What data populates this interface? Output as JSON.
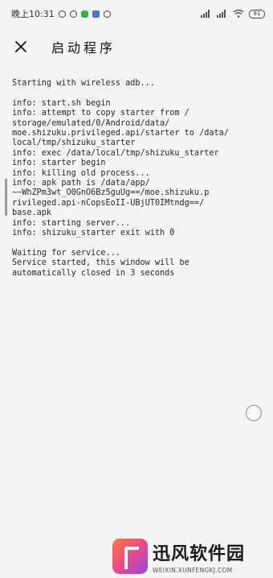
{
  "status_bar": {
    "time": "晚上10:31",
    "battery": "91"
  },
  "header": {
    "title": "启动程序"
  },
  "console": {
    "lines": [
      "Starting with wireless adb...",
      "",
      "info: start.sh begin",
      "info: attempt to copy starter from /",
      "storage/emulated/0/Android/data/",
      "moe.shizuku.privileged.api/starter to /data/",
      "local/tmp/shizuku_starter",
      "info: exec /data/local/tmp/shizuku_starter",
      "info: starter begin",
      "info: killing old process...",
      "info: apk path is /data/app/",
      "~~WhZPm3wt_O0GnO6Bz5guUg==/moe.shizuku.p",
      "rivileged.api-nCopsEoII-UBjUT0IMtndg==/",
      "base.apk",
      "info: starting server...",
      "info: shizuku_starter exit with 0",
      "",
      "Waiting for service...",
      "Service started, this window will be",
      "automatically closed in 3 seconds"
    ]
  },
  "watermark": {
    "name": "迅风软件园",
    "url": "WEIXIN.XUNFENGKJ.COM"
  }
}
